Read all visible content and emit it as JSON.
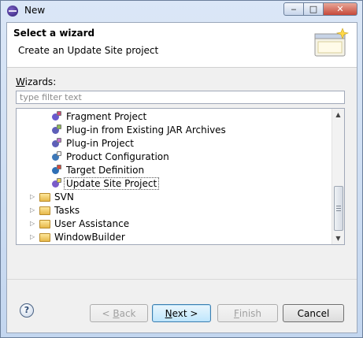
{
  "window": {
    "title": "New",
    "min_glyph": "‒",
    "max_glyph": "□",
    "close_glyph": "✕"
  },
  "banner": {
    "title": "Select a wizard",
    "description": "Create an Update Site project"
  },
  "wizards_label": {
    "mnemonic": "W",
    "rest": "izards:"
  },
  "filter": {
    "placeholder": "type filter text",
    "value": ""
  },
  "tree": {
    "items": [
      {
        "label": "Fragment Project",
        "icon": "fragment-project-icon",
        "kind": "leaf"
      },
      {
        "label": "Plug-in from Existing JAR Archives",
        "icon": "plugin-jar-icon",
        "kind": "leaf"
      },
      {
        "label": "Plug-in Project",
        "icon": "plugin-project-icon",
        "kind": "leaf"
      },
      {
        "label": "Product Configuration",
        "icon": "product-configuration-icon",
        "kind": "leaf"
      },
      {
        "label": "Target Definition",
        "icon": "target-definition-icon",
        "kind": "leaf"
      },
      {
        "label": "Update Site Project",
        "icon": "update-site-icon",
        "kind": "leaf",
        "selected": true
      },
      {
        "label": "SVN",
        "icon": "folder-icon",
        "kind": "folder"
      },
      {
        "label": "Tasks",
        "icon": "folder-icon",
        "kind": "folder"
      },
      {
        "label": "User Assistance",
        "icon": "folder-icon",
        "kind": "folder"
      },
      {
        "label": "WindowBuilder",
        "icon": "folder-icon",
        "kind": "folder"
      }
    ],
    "twisty_glyph": "▷",
    "scroll_up_glyph": "▲",
    "scroll_down_glyph": "▼"
  },
  "footer": {
    "help_glyph": "?",
    "back": {
      "prefix": "< ",
      "mnemonic": "B",
      "rest": "ack",
      "enabled": false
    },
    "next": {
      "mnemonic": "N",
      "rest": "ext >",
      "enabled": true
    },
    "finish": {
      "mnemonic": "F",
      "rest": "inish",
      "enabled": false
    },
    "cancel": {
      "label": "Cancel",
      "enabled": true
    }
  },
  "colors": {
    "selection_border": "#555555",
    "default_button": "#3c7fb1",
    "title_bg": "#c8d9ef"
  }
}
